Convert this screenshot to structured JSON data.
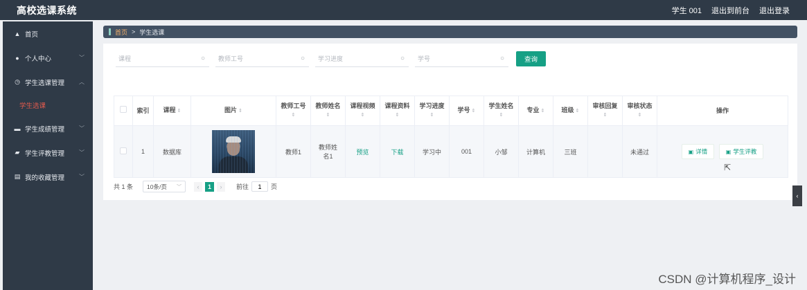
{
  "app": {
    "title": "高校选课系统"
  },
  "header": {
    "user": "学生 001",
    "front_link": "退出到前台",
    "logout_link": "退出登录"
  },
  "sidebar": {
    "items": [
      {
        "label": "首页",
        "icon": "home-icon"
      },
      {
        "label": "个人中心",
        "icon": "user-icon"
      },
      {
        "label": "学生选课管理",
        "icon": "clock-icon"
      },
      {
        "label": "学生成绩管理",
        "icon": "book-icon"
      },
      {
        "label": "学生评教管理",
        "icon": "ticket-icon"
      },
      {
        "label": "我的收藏管理",
        "icon": "clipboard-icon"
      }
    ],
    "active_sub": "学生选课"
  },
  "breadcrumb": {
    "home": "首页",
    "sep": ">",
    "current": "学生选课"
  },
  "search": {
    "course_placeholder": "课程",
    "teacher_id_placeholder": "教师工号",
    "progress_placeholder": "学习进度",
    "student_id_placeholder": "学号",
    "query_label": "查询"
  },
  "table": {
    "headers": [
      "索引",
      "课程",
      "图片",
      "教师工号",
      "教师姓名",
      "课程视频",
      "课程资料",
      "学习进度",
      "学号",
      "学生姓名",
      "专业",
      "班级",
      "审核回复",
      "审核状态",
      "操作"
    ],
    "sort_symbol": "⇕",
    "rows": [
      {
        "index": "1",
        "course": "数据库",
        "teacher_id": "教师1",
        "teacher_name": "教师姓名1",
        "video": "预览",
        "material": "下载",
        "progress": "学习中",
        "student_id": "001",
        "student_name": "小邹",
        "major": "计算机",
        "class": "三班",
        "reply": "",
        "status": "未通过",
        "btn_detail": "详情",
        "btn_evaluate": "学生评教"
      }
    ]
  },
  "pagination": {
    "total": "共 1 条",
    "page_size": "10条/页",
    "current_page": "1",
    "goto_label": "前往",
    "goto_value": "1",
    "page_suffix": "页"
  },
  "watermark": "CSDN @计算机程序_设计",
  "colors": {
    "primary": "#16a085",
    "sidebar": "#2f3a47",
    "breadcrumb": "#425163",
    "active_menu": "#e05a4d"
  }
}
